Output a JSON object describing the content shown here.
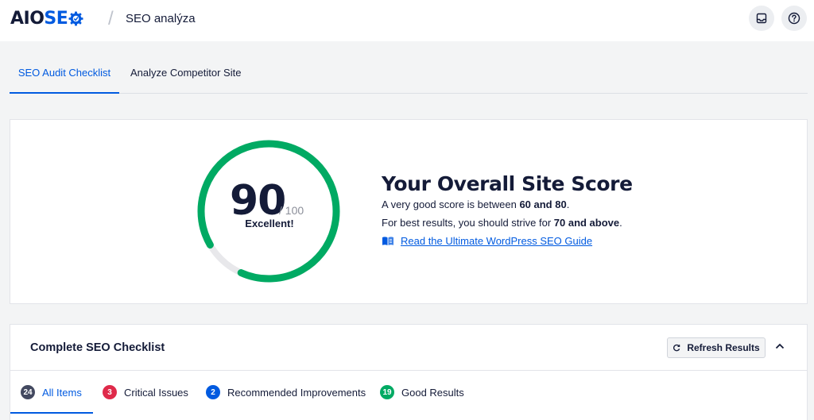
{
  "header": {
    "logo_prefix": "AIO",
    "logo_suffix": "SE",
    "separator": "/",
    "title": "SEO analýza",
    "icons": [
      "inbox-icon",
      "help-icon"
    ]
  },
  "tabs": [
    {
      "label": "SEO Audit Checklist",
      "active": true
    },
    {
      "label": "Analyze Competitor Site",
      "active": false
    }
  ],
  "score": {
    "value": "90",
    "max": "/ 100",
    "fraction": 0.9,
    "rating": "Excellent!",
    "title": "Your Overall Site Score",
    "line1_pre": "A very good score is between ",
    "line1_bold": "60 and 80",
    "line1_post": ".",
    "line2_pre": "For best results, you should strive for ",
    "line2_bold": "70 and above",
    "line2_post": ".",
    "guide_link": "Read the Ultimate WordPress SEO Guide",
    "colors": {
      "good": "#00aa63",
      "track": "#e8e8eb",
      "accent": "#005ae0"
    }
  },
  "checklist": {
    "title": "Complete SEO Checklist",
    "refresh_label": "Refresh Results",
    "filters": [
      {
        "count": "24",
        "label": "All Items",
        "color": "#434960",
        "active": true
      },
      {
        "count": "3",
        "label": "Critical Issues",
        "color": "#df2a4a",
        "active": false
      },
      {
        "count": "2",
        "label": "Recommended Improvements",
        "color": "#005ae0",
        "active": false
      },
      {
        "count": "19",
        "label": "Good Results",
        "color": "#00aa63",
        "active": false
      }
    ]
  }
}
